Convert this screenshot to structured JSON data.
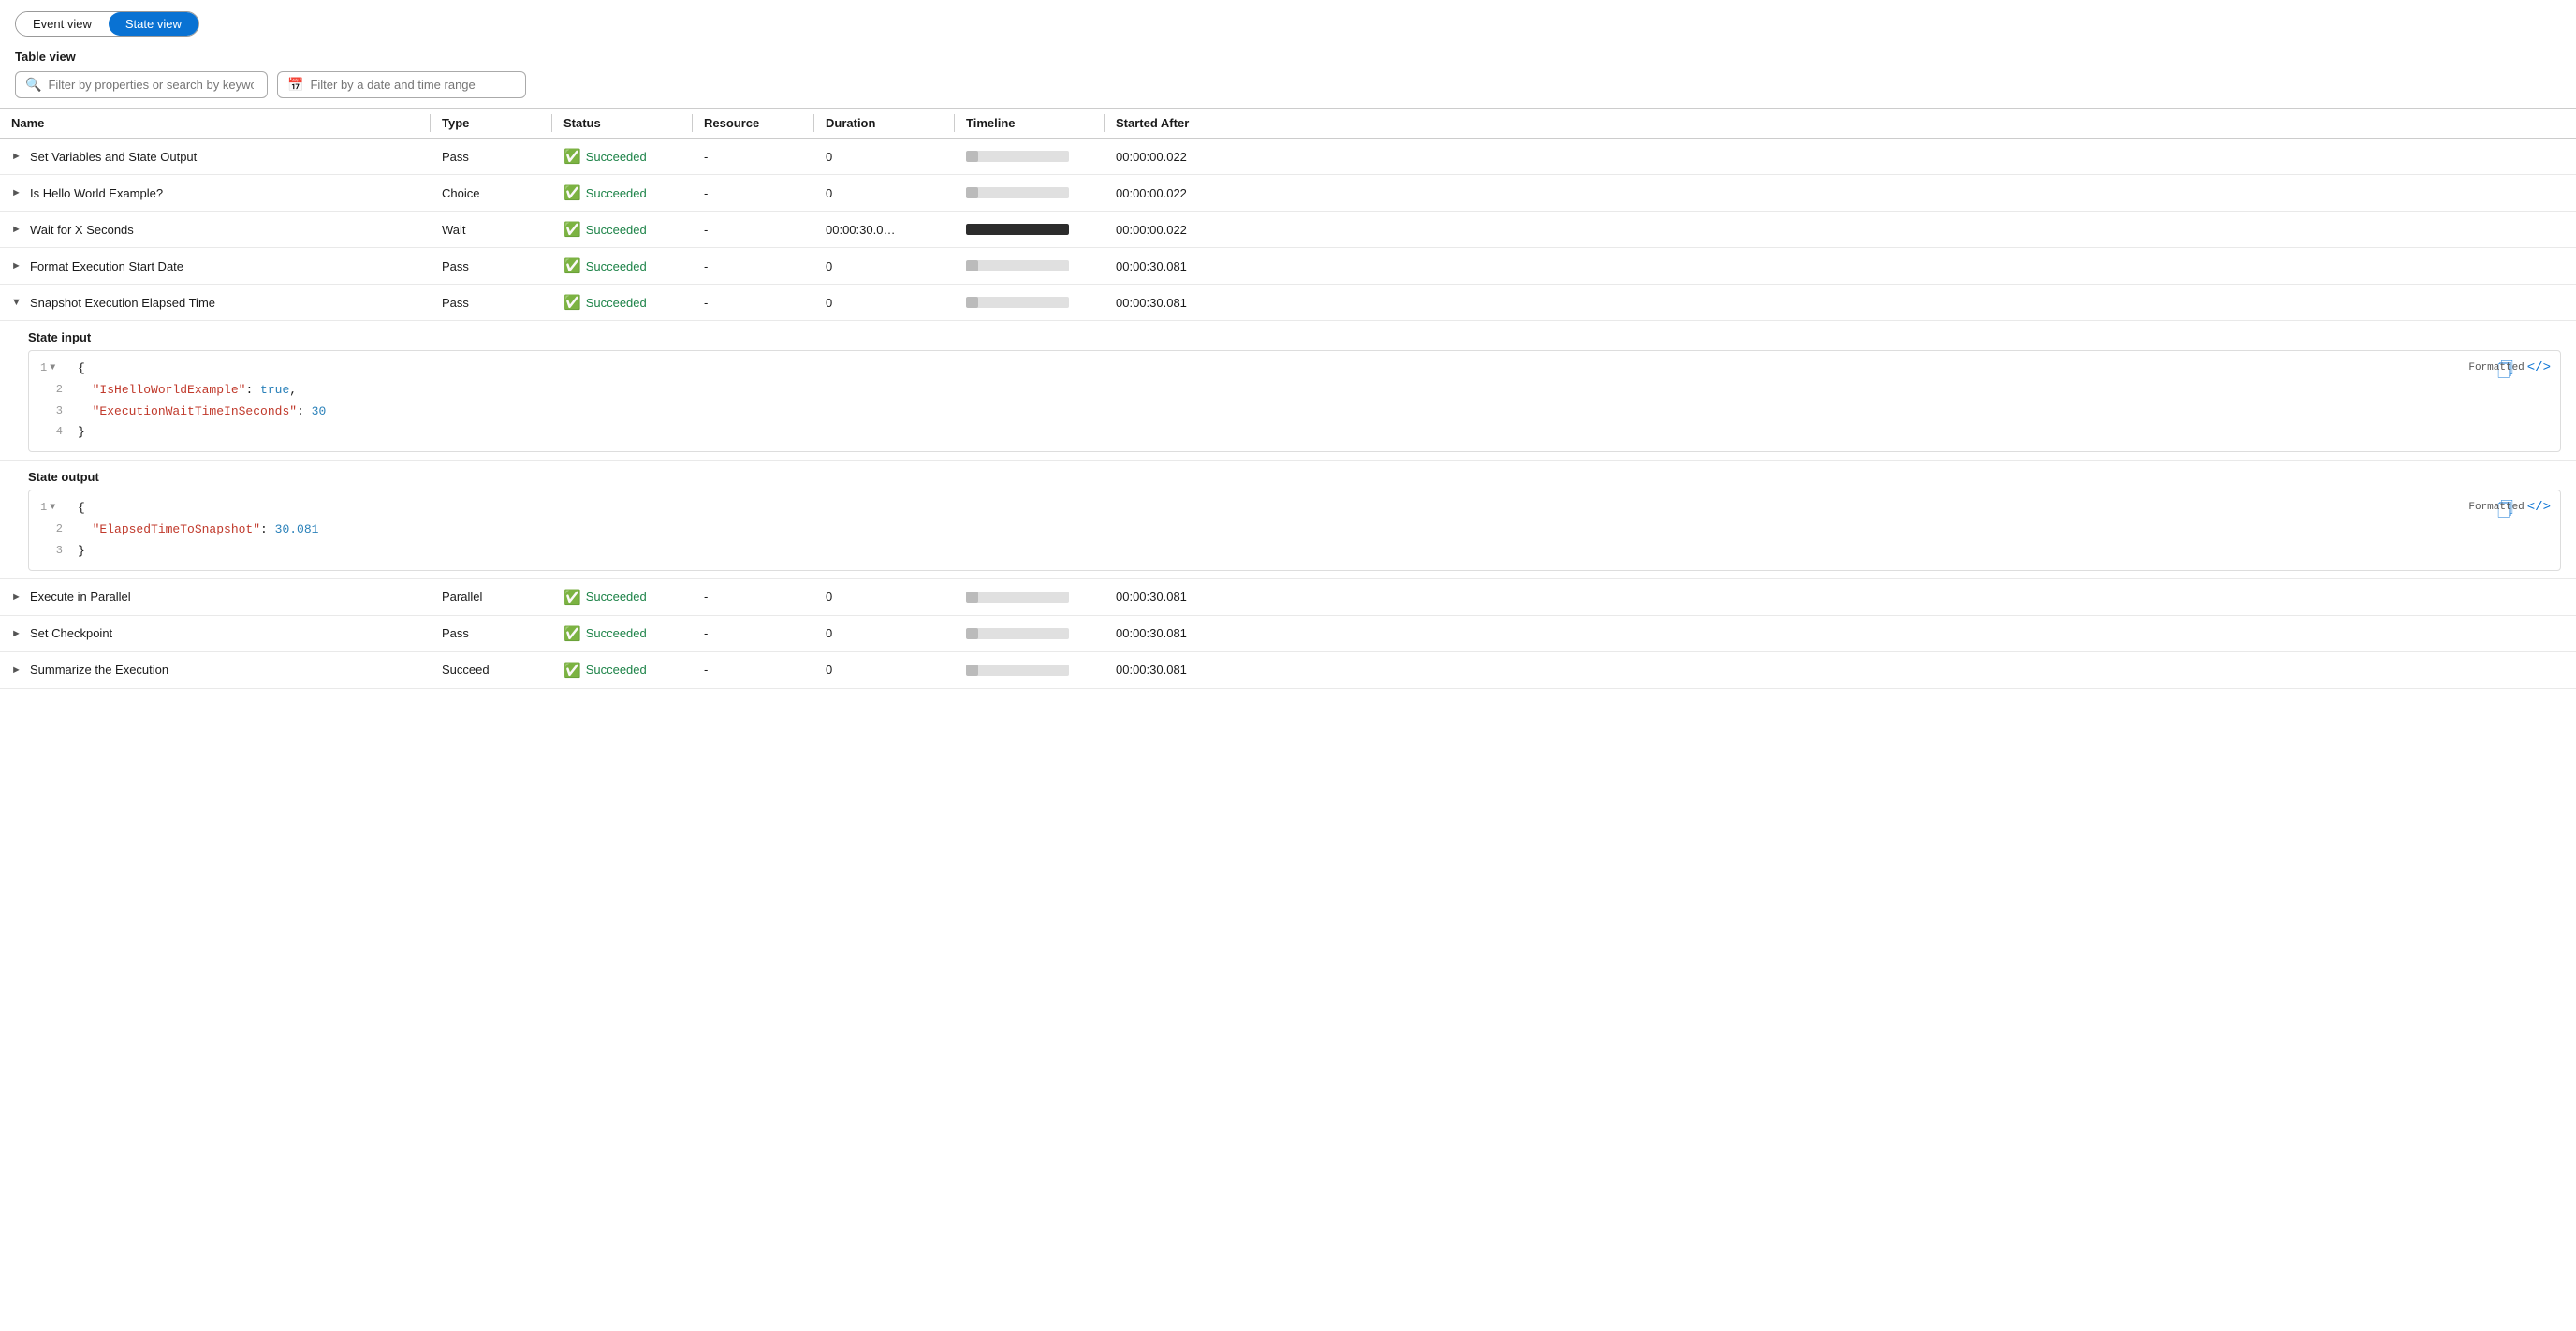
{
  "views": {
    "event_label": "Event view",
    "state_label": "State view",
    "active": "state"
  },
  "table": {
    "view_label": "Table view",
    "filter_placeholder": "Filter by properties or search by keyword",
    "date_placeholder": "Filter by a date and time range",
    "columns": [
      "Name",
      "Type",
      "Status",
      "Resource",
      "Duration",
      "Timeline",
      "Started After"
    ],
    "rows": [
      {
        "name": "Set Variables and State Output",
        "expanded": false,
        "type": "Pass",
        "status": "Succeeded",
        "resource": "-",
        "duration": "0",
        "timeline_pct": 12,
        "started_after": "00:00:00.022"
      },
      {
        "name": "Is Hello World Example?",
        "expanded": false,
        "type": "Choice",
        "status": "Succeeded",
        "resource": "-",
        "duration": "0",
        "timeline_pct": 12,
        "started_after": "00:00:00.022"
      },
      {
        "name": "Wait for X Seconds",
        "expanded": false,
        "type": "Wait",
        "status": "Succeeded",
        "resource": "-",
        "duration": "00:00:30.0…",
        "timeline_pct": 100,
        "started_after": "00:00:00.022"
      },
      {
        "name": "Format Execution Start Date",
        "expanded": false,
        "type": "Pass",
        "status": "Succeeded",
        "resource": "-",
        "duration": "0",
        "timeline_pct": 12,
        "started_after": "00:00:30.081"
      },
      {
        "name": "Snapshot Execution Elapsed Time",
        "expanded": true,
        "type": "Pass",
        "status": "Succeeded",
        "resource": "-",
        "duration": "0",
        "timeline_pct": 12,
        "started_after": "00:00:30.081"
      }
    ],
    "state_input_label": "State input",
    "state_input_lines": [
      {
        "num": "1",
        "fold": true,
        "content": "{"
      },
      {
        "num": "2",
        "fold": false,
        "content": "  \"IsHelloWorldExample\": true,"
      },
      {
        "num": "3",
        "fold": false,
        "content": "  \"ExecutionWaitTimeInSeconds\": 30"
      },
      {
        "num": "4",
        "fold": false,
        "content": "}"
      }
    ],
    "state_output_label": "State output",
    "state_output_lines": [
      {
        "num": "1",
        "fold": true,
        "content": "{"
      },
      {
        "num": "2",
        "fold": false,
        "content": "  \"ElapsedTimeToSnapshot\": 30.081"
      },
      {
        "num": "3",
        "fold": false,
        "content": "}"
      }
    ],
    "formatted_label": "Formatted",
    "rows_after": [
      {
        "name": "Execute in Parallel",
        "expanded": false,
        "type": "Parallel",
        "status": "Succeeded",
        "resource": "-",
        "duration": "0",
        "timeline_pct": 12,
        "started_after": "00:00:30.081"
      },
      {
        "name": "Set Checkpoint",
        "expanded": false,
        "type": "Pass",
        "status": "Succeeded",
        "resource": "-",
        "duration": "0",
        "timeline_pct": 12,
        "started_after": "00:00:30.081"
      },
      {
        "name": "Summarize the Execution",
        "expanded": false,
        "type": "Succeed",
        "status": "Succeeded",
        "resource": "-",
        "duration": "0",
        "timeline_pct": 12,
        "started_after": "00:00:30.081"
      }
    ]
  }
}
